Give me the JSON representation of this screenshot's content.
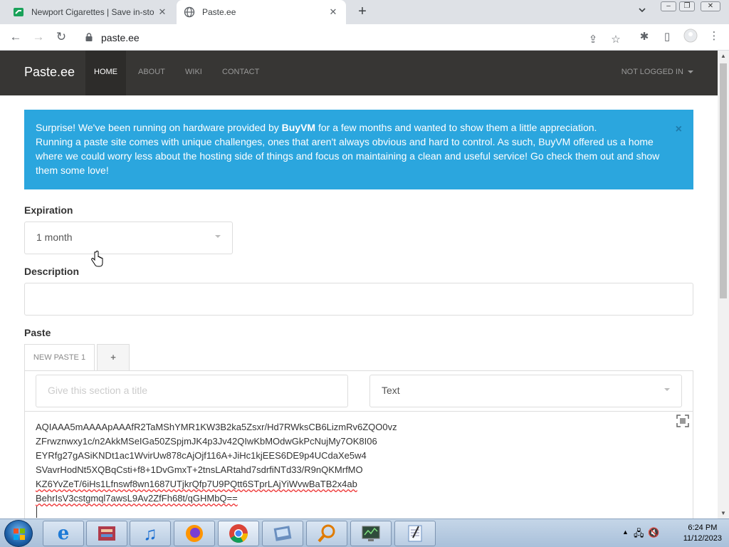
{
  "browser": {
    "tabs": [
      {
        "title": "Newport Cigarettes | Save in-sto",
        "active": false
      },
      {
        "title": "Paste.ee",
        "active": true
      }
    ],
    "url": "paste.ee"
  },
  "site": {
    "brand": "Paste.ee",
    "nav": [
      "HOME",
      "ABOUT",
      "WIKI",
      "CONTACT"
    ],
    "account": "NOT LOGGED IN"
  },
  "alert": {
    "line1_pre": "Surprise! We've been running on hardware provided by ",
    "line1_bold": "BuyVM",
    "line1_post": " for a few months and wanted to show them a little appreciation.",
    "line2": "Running a paste site comes with unique challenges, ones that aren't always obvious and hard to control. As such, BuyVM offered us a home where we could worry less about the hosting side of things and focus on maintaining a clean and useful service! Go check them out and show them some love!",
    "close": "×"
  },
  "form": {
    "expiration_label": "Expiration",
    "expiration_value": "1 month",
    "description_label": "Description",
    "description_value": "",
    "paste_label": "Paste",
    "tab_name": "NEW PASTE 1",
    "add_tab": "+",
    "section_title_placeholder": "Give this section a title",
    "syntax_value": "Text",
    "code_lines": [
      "AQIAAA5mAAAApAAAfR2TaMShYMR1KW3B2ka5Zsxr/Hd7RWksCB6LizmRv6ZQO0vz",
      "ZFrwznwxy1c/n2AkkMSeIGa50ZSpjmJK4p3Jv42QIwKbMOdwGkPcNujMy7OK8I06",
      "EYRfg27gASiKNDt1ac1WvirUw878cAjOjf116A+JiHc1kjEES6DE9p4UCdaXe5w4",
      "SVavrHodNt5XQBqCsti+f8+1DvGmxT+2tnsLARtahd7sdrfiNTd33/R9nQKMrfMO",
      "KZ6YvZeT/6iHs1Lfnswf8wn1687UTjkrQfp7U9PQtt6STprLAjYiWvwBaTB2x4ab",
      "BehrIsV3cstgmql7awsL9Av2ZfFh68t/qGHMbQ=="
    ]
  },
  "taskbar": {
    "time": "6:24 PM",
    "date": "11/12/2023"
  }
}
